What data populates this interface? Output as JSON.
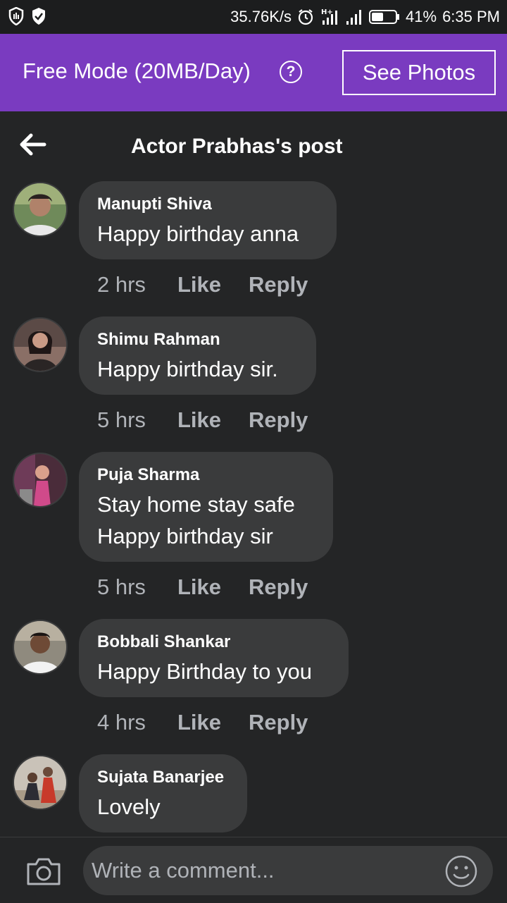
{
  "status_bar": {
    "net_speed": "35.76K/s",
    "battery": "41%",
    "time": "6:35 PM",
    "icons": [
      "shield-icon",
      "shield-check-icon",
      "alarm-icon",
      "signal-hplus-icon",
      "signal-icon",
      "battery-icon"
    ]
  },
  "banner": {
    "text": "Free Mode (20MB/Day)",
    "help": "?",
    "button": "See Photos",
    "color": "#7a3bc0"
  },
  "header": {
    "title": "Actor Prabhas's post",
    "back_icon": "arrow-left-icon"
  },
  "comments": [
    {
      "author": "Manupti Shiva",
      "text": "Happy birthday anna",
      "time": "2 hrs",
      "like": "Like",
      "reply": "Reply"
    },
    {
      "author": "Shimu Rahman",
      "text": "Happy birthday sir.",
      "time": "5 hrs",
      "like": "Like",
      "reply": "Reply"
    },
    {
      "author": "Puja Sharma",
      "text": "Stay home stay safe\nHappy birthday sir",
      "time": "5 hrs",
      "like": "Like",
      "reply": "Reply"
    },
    {
      "author": "Bobbali Shankar",
      "text": "Happy Birthday to you",
      "time": "4 hrs",
      "like": "Like",
      "reply": "Reply"
    },
    {
      "author": "Sujata Banarjee",
      "text": "Lovely"
    }
  ],
  "composer": {
    "placeholder": "Write a comment...",
    "camera_icon": "camera-icon",
    "emoji_icon": "smiley-icon"
  }
}
